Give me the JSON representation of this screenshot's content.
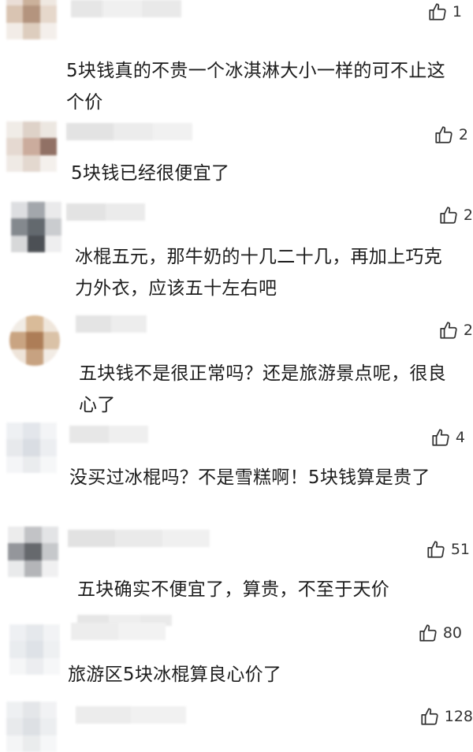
{
  "comments": [
    {
      "likes": "1",
      "text": "5块钱真的不贵一个冰淇淋大小一样的可不止这个价",
      "icon": "thumbs-up-icon"
    },
    {
      "likes": "2",
      "text": "5块钱已经很便宜了",
      "icon": "thumbs-up-icon"
    },
    {
      "likes": "2",
      "text": "冰棍五元，那牛奶的十几二十几，再加上巧克力外衣，应该五十左右吧",
      "icon": "thumbs-up-icon"
    },
    {
      "likes": "2",
      "text": "五块钱不是很正常吗？还是旅游景点呢，很良心了",
      "icon": "thumbs-up-icon"
    },
    {
      "likes": "4",
      "text": "没买过冰棍吗？不是雪糕啊！5块钱算是贵了",
      "icon": "thumbs-up-icon"
    },
    {
      "likes": "51",
      "text": "五块确实不便宜了，算贵，不至于天价",
      "icon": "thumbs-up-icon"
    },
    {
      "likes": "80",
      "text": "旅游区5块冰棍算良心价了",
      "icon": "thumbs-up-icon"
    },
    {
      "likes": "128",
      "text": "",
      "icon": "thumbs-up-icon"
    }
  ]
}
